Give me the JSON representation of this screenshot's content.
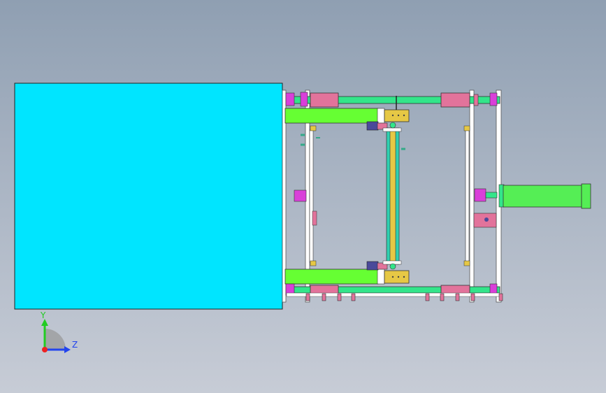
{
  "viewport": {
    "background_top": "#8f9fb2",
    "background_bottom": "#c7ccd6"
  },
  "model": {
    "colors": {
      "box": "#00e5ff",
      "frame": "#ffffff",
      "rod": "#33e58a",
      "cylinder": "#e2739b",
      "end_cap": "#d93fd9",
      "guide_bar": "#66ff33",
      "bracket": "#e6c845",
      "rail": "#2fd0b0",
      "motor": "#4a4a9a",
      "actuator": "#55ee55",
      "edge": "#333333"
    }
  },
  "triad": {
    "y_label": "Y",
    "z_label": "Z",
    "y_color": "#22cc22",
    "z_color": "#2244ee",
    "origin_color": "#ee2222"
  }
}
